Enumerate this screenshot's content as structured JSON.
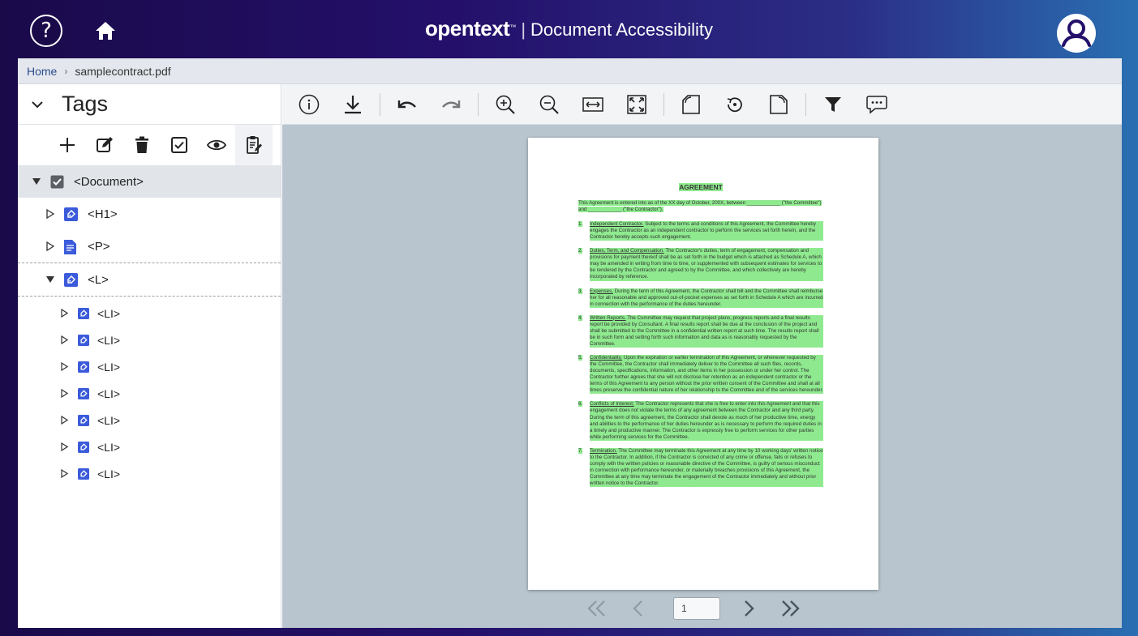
{
  "app": {
    "brand": "opentext",
    "brand_tm": "™",
    "separator": "|",
    "product": "Document Accessibility"
  },
  "topbar": {
    "help_label": "?",
    "icons": [
      "help-icon",
      "home-icon",
      "user-avatar-icon"
    ]
  },
  "breadcrumb": {
    "home": "Home",
    "separator": "›",
    "current": "samplecontract.pdf"
  },
  "tags_panel": {
    "title": "Tags",
    "toolbar": [
      "add-icon",
      "edit-icon",
      "delete-icon",
      "checkbox-icon",
      "eye-icon",
      "clipboard-edit-icon"
    ],
    "tree": {
      "document": "<Document>",
      "h1": "<H1>",
      "p": "<P>",
      "l": "<L>",
      "li_items": [
        "<LI>",
        "<LI>",
        "<LI>",
        "<LI>",
        "<LI>",
        "<LI>",
        "<LI>"
      ]
    }
  },
  "viewer": {
    "toolbar": [
      "info-icon",
      "download-icon",
      "undo-icon",
      "redo-icon",
      "zoom-in-icon",
      "zoom-out-icon",
      "fit-width-icon",
      "fit-page-icon",
      "rotate-left-icon",
      "reset-rotation-icon",
      "rotate-right-icon",
      "filter-icon",
      "comment-icon"
    ],
    "pager": {
      "page_value": "1",
      "icons": [
        "first-page-icon",
        "prev-page-icon",
        "next-page-icon",
        "last-page-icon"
      ]
    }
  },
  "document": {
    "title": "AGREEMENT",
    "intro": "This Agreement is entered into as of the XX day of October, 200X, between ____________ (\"the Committee\") and ____________ (\"the Contractor\").",
    "items": [
      {
        "num": "1.",
        "heading": "Independent Contractor.",
        "body": " Subject to the terms and conditions of this Agreement, the Committee hereby engages the Contractor as an independent contractor to perform the services set forth herein, and the Contractor hereby accepts such engagement."
      },
      {
        "num": "2.",
        "heading": "Duties, Term, and Compensation.",
        "body": " The Contractor's duties, term of engagement, compensation and provisions for payment thereof shall be as set forth in the budget which is attached as Schedule A, which may be amended in writing from time to time, or supplemented with subsequent estimates for services to be rendered by the Contractor and agreed to by the Committee, and which collectively are hereby incorporated by reference."
      },
      {
        "num": "3.",
        "heading": "Expenses.",
        "body": " During the term of this Agreement, the Contractor shall bill and the Committee shall reimburse her for all reasonable and approved out-of-pocket expenses as set forth in Schedule A which are incurred in connection with the performance of the duties hereunder."
      },
      {
        "num": "4.",
        "heading": "Written Reports.",
        "body": " The Committee may request that project plans, progress reports and a final results report be provided by Consultant. A final results report shall be due at the conclusion of the project and shall be submitted to the Committee in a confidential written report at such time. The results report shall be in such form and setting forth such information and data as is reasonably requested by the Committee."
      },
      {
        "num": "5.",
        "heading": "Confidentiality.",
        "body": " Upon the expiration or earlier termination of this Agreement, or whenever requested by the Committee, the Contractor shall immediately deliver to the Committee all such files, records, documents, specifications, information, and other items in her possession or under her control. The Contractor further agrees that she will not disclose her retention as an independent contractor or the terms of this Agreement to any person without the prior written consent of the Committee and shall at all times preserve the confidential nature of her relationship to the Committee and of the services hereunder."
      },
      {
        "num": "6.",
        "heading": "Conflicts of Interest;",
        "body": " The Contractor represents that she is free to enter into this Agreement and that this engagement does not violate the terms of any agreement between the Contractor and any third party. During the term of this agreement, the Contractor shall devote as much of her productive time, energy and abilities to the performance of her duties hereunder as is necessary to perform the required duties in a timely and productive manner. The Contractor is expressly free to perform services for other parties while performing services for the Committee."
      },
      {
        "num": "7.",
        "heading": "Termination.",
        "body": " The Committee may terminate this Agreement at any time by 10 working days' written notice to the Contractor. In addition, if the Contractor is convicted of any crime or offense, fails or refuses to comply with the written policies or reasonable directive of the Committee, is guilty of serious misconduct in connection with performance hereunder, or materially breaches provisions of this Agreement, the Committee at any time may terminate the engagement of the Contractor immediately and without prior written notice to the Contractor."
      }
    ]
  },
  "colors": {
    "highlight": "#8fea8f",
    "tag_icon": "#3b5bdb",
    "header_bg_start": "#1a0a4a",
    "header_bg_end": "#2a6fb2"
  }
}
